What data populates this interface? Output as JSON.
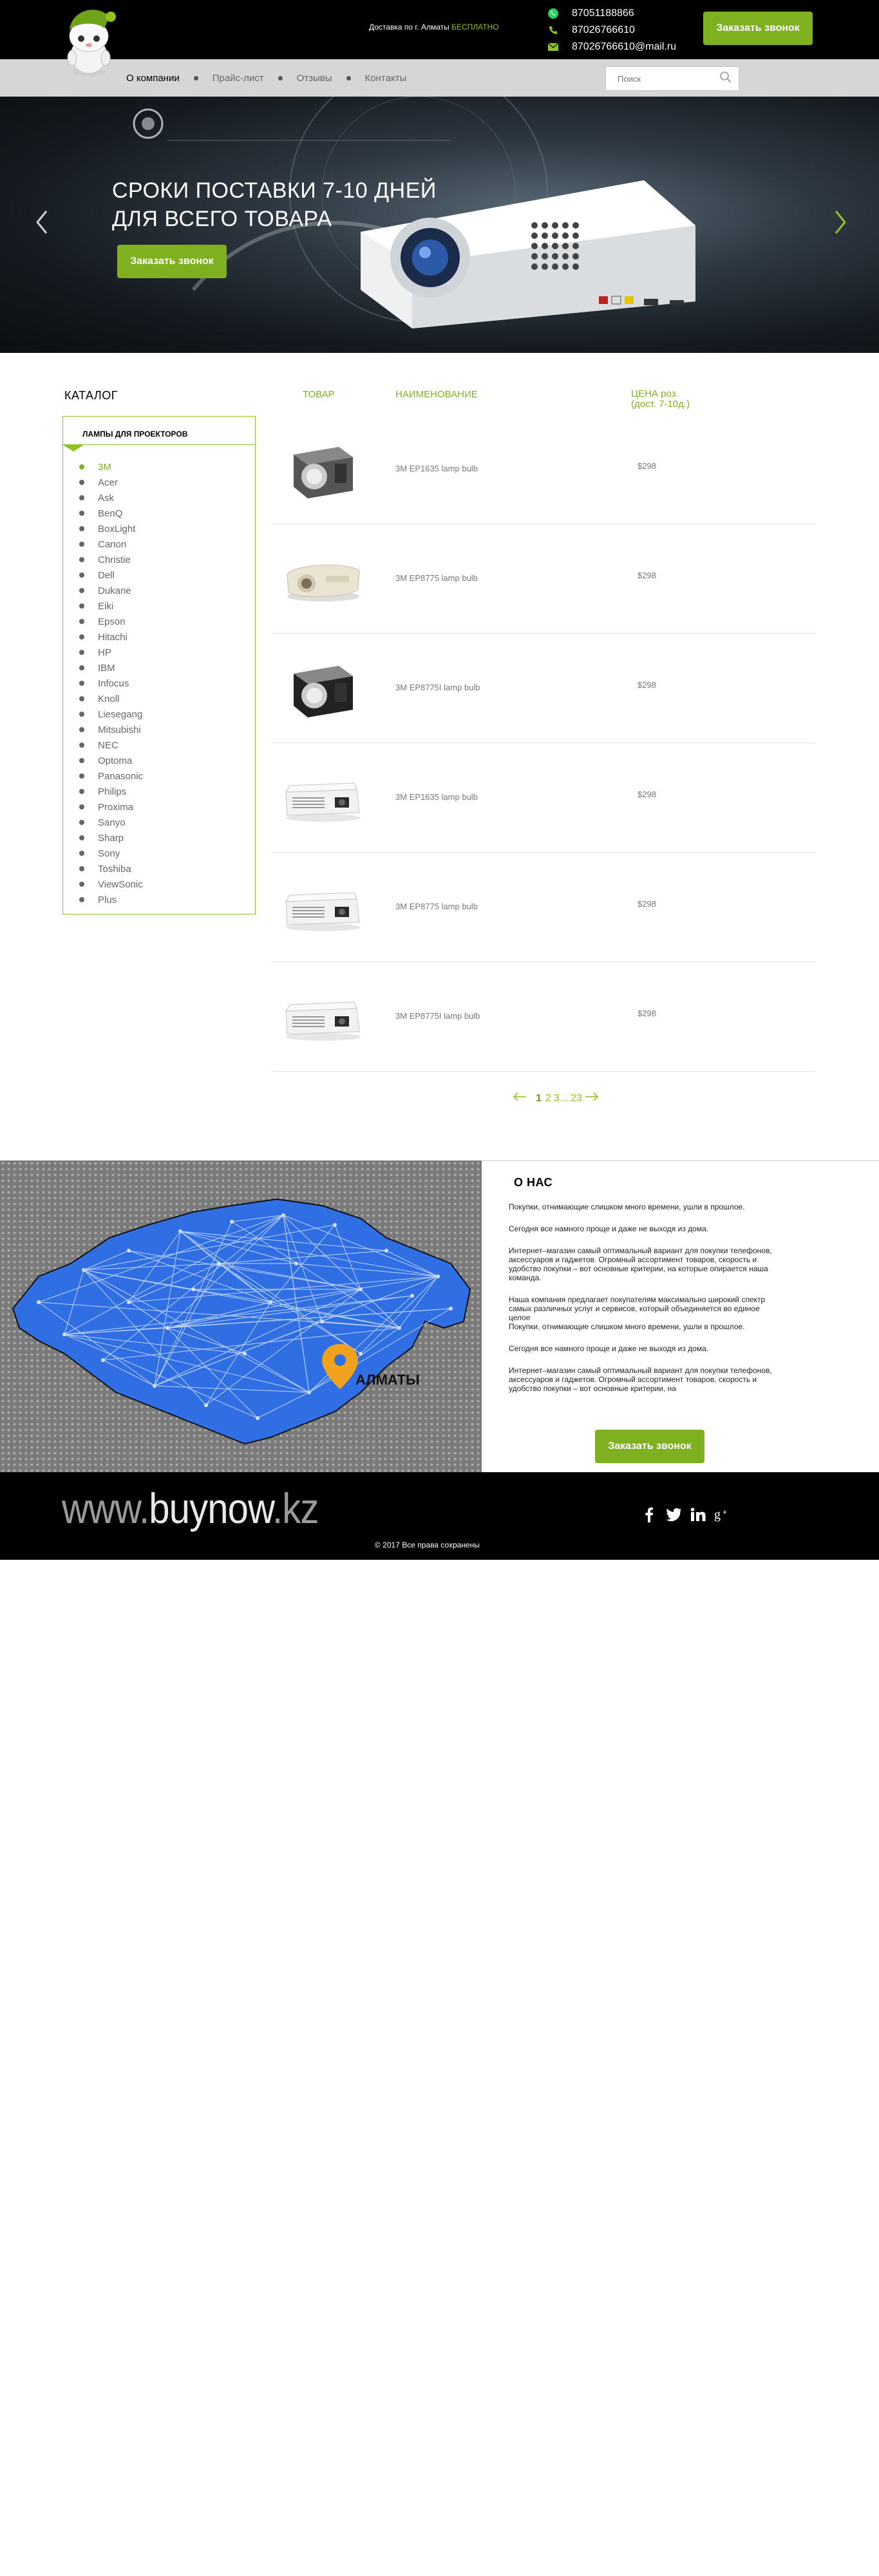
{
  "header": {
    "delivery_text": "Доставка по г. Алматы",
    "delivery_free": "БЕСПЛАТНО",
    "contacts": [
      {
        "icon": "whatsapp-icon",
        "text": "87051188866"
      },
      {
        "icon": "phone-icon",
        "text": "87026766610"
      },
      {
        "icon": "mail-icon",
        "text": "87026766610@mail.ru"
      }
    ],
    "call_button": "Заказать звонок"
  },
  "nav": {
    "items": [
      {
        "label": "О компании",
        "active": true
      },
      {
        "label": "Прайс-лист",
        "active": false
      },
      {
        "label": "Отзывы",
        "active": false
      },
      {
        "label": "Контакты",
        "active": false
      }
    ],
    "search_placeholder": "Поиск"
  },
  "hero": {
    "title_line1": "СРОКИ ПОСТАВКИ 7-10 ДНЕЙ",
    "title_line2": "ДЛЯ ВСЕГО ТОВАРА",
    "button": "Заказать звонок"
  },
  "catalog": {
    "title": "КАТАЛОГ",
    "category": "ЛАМПЫ ДЛЯ ПРОЕКТОРОВ",
    "brands": [
      "3M",
      "Acer",
      "Ask",
      "BenQ",
      "BoxLight",
      "Canon",
      "Christie",
      "Dell",
      "Dukane",
      "Eiki",
      "Epson",
      "Hitachi",
      "HP",
      "IBM",
      "Infocus",
      "Knoll",
      "Liesegang",
      "Mitsubishi",
      "NEC",
      "Optoma",
      "Panasonic",
      "Philips",
      "Proxima",
      "Sanyo",
      "Sharp",
      "Sony",
      "Toshiba",
      "ViewSonic",
      "Plus"
    ],
    "active_brand": "3M"
  },
  "table": {
    "col_product": "ТОВАР",
    "col_name": "НАИМЕНОВАНИЕ",
    "col_price_line1": "ЦЕНА роз.",
    "col_price_line2": "(дост. 7-10д.)",
    "rows": [
      {
        "name": "3M EP1635 lamp bulb",
        "price": "$298",
        "image": "lamp-module"
      },
      {
        "name": "3M EP8775 lamp bulb",
        "price": "$298",
        "image": "home-projector"
      },
      {
        "name": "3M EP8775I lamp bulb",
        "price": "$298",
        "image": "lamp-module-dark"
      },
      {
        "name": "3M EP1635 lamp bulb",
        "price": "$298",
        "image": "office-projector"
      },
      {
        "name": "3M EP8775 lamp bulb",
        "price": "$298",
        "image": "office-projector"
      },
      {
        "name": "3M EP8775I lamp bulb",
        "price": "$298",
        "image": "office-projector"
      }
    ]
  },
  "pager": {
    "current": "1",
    "pages": [
      "2",
      "3"
    ],
    "ellipsis": "...",
    "last": "23"
  },
  "about": {
    "map_label": "АЛМАТЫ",
    "title": "О НАС",
    "paragraphs": [
      "Покупки, отнимающие слишком много времени, ушли в прошлое.",
      "Сегодня все намного проще и даже не выходя из дома.",
      "Интернет–магазин самый оптимальный вариант для покупки телефонов, аксессуаров и гаджетов. Огромный ассортимент товаров, скорость и удобство покупки – вот основные критерии, на которые опирается наша команда.",
      "Наша компания предлагает покупателям максимально широкий спектр самых различных услуг и сервисов, который объединяется во единое целое\nПокупки, отнимающие слишком много времени, ушли в прошлое.",
      "Сегодня все намного проще и даже не выходя из дома.",
      "Интернет–магазин самый оптимальный вариант для покупки телефонов, аксессуаров и гаджетов. Огромный ассортимент товаров, скорость и удобство покупки – вот основные критерии, на"
    ],
    "button": "Заказать звонок"
  },
  "footer": {
    "logo_prefix": "www.",
    "logo_main": "buynow",
    "logo_suffix": ".kz",
    "socials": [
      "facebook-icon",
      "twitter-icon",
      "linkedin-icon",
      "google-plus-icon"
    ],
    "copyright": "©   2017 Все права сохранены"
  },
  "colors": {
    "accent": "#7fb01f",
    "header_bg": "#000000",
    "nav_bg": "#d6d6d6",
    "map_blue": "#2a6de0"
  }
}
